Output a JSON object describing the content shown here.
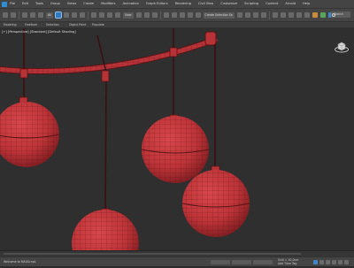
{
  "menu": {
    "items": [
      "File",
      "Edit",
      "Tools",
      "Group",
      "Views",
      "Create",
      "Modifiers",
      "Animation",
      "Graph Editors",
      "Rendering",
      "Civil View",
      "Customize",
      "Scripting",
      "Content",
      "Arnold",
      "Help"
    ]
  },
  "toolbar": {
    "selection_filter": "All",
    "view_dropdown": "View",
    "selection_set": "Create Selection Se",
    "search_placeholder": "Search"
  },
  "ribbon": {
    "tabs": [
      "Modeling",
      "Freeform",
      "Selection",
      "Object Paint",
      "Populate"
    ]
  },
  "viewport": {
    "label": "[+] [Perspective] [Standard] [Default Shading]"
  },
  "status": {
    "welcome": "Welcome to MAXScript.",
    "grid": "Grid = 10,0cm",
    "key": "Add Time Tag"
  },
  "colors": {
    "ornament": "#c0393d",
    "ornament_shadow": "#5a1416",
    "wire": "#3a1012",
    "accent": "#2f8ed8"
  }
}
